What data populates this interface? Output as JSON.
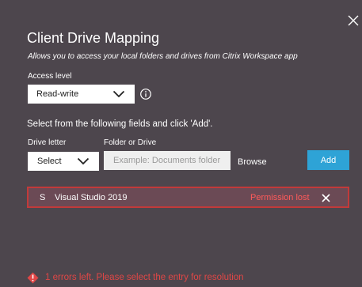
{
  "dialog": {
    "title": "Client Drive Mapping",
    "subtitle": "Allows you to access your local folders and drives from Citrix Workspace app"
  },
  "access_level": {
    "label": "Access level",
    "value": "Read-write"
  },
  "instruction": "Select from the following fields and click 'Add'.",
  "drive_letter": {
    "label": "Drive letter",
    "value": "Select"
  },
  "folder": {
    "label": "Folder or Drive",
    "placeholder": "Example: Documents folder"
  },
  "browse_label": "Browse",
  "add_label": "Add",
  "entries": [
    {
      "letter": "S",
      "name": "Visual Studio 2019",
      "status": "Permission lost"
    }
  ],
  "error_message": "1 errors left. Please select the entry for resolution",
  "colors": {
    "background": "#4d464d",
    "accent": "#2ea3d6",
    "error": "#e04646"
  },
  "icons": {
    "close": "close-icon",
    "info": "info-icon",
    "chevron": "chevron-down-icon",
    "error": "error-diamond-icon",
    "remove": "remove-icon"
  }
}
